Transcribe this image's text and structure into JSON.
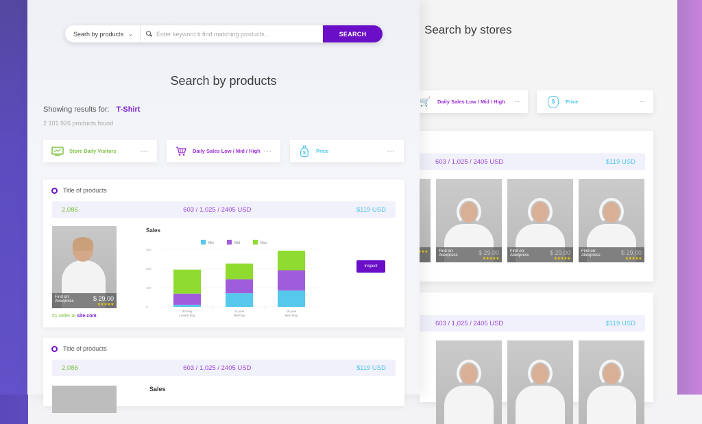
{
  "products_panel": {
    "search": {
      "select_value": "Searh by products",
      "placeholder": "Enter keyword ti find matching products...",
      "button": "SEARCH"
    },
    "title": "Search by products",
    "showing_label": "Showing results for:",
    "search_term": "T-Shirt",
    "found": "2 101 926 products found",
    "filters": [
      {
        "icon": "monitor-chart-icon",
        "label": "Store Daily Visitors",
        "color": "#7cc240"
      },
      {
        "icon": "shopping-cart-icon",
        "label": "Daily Sales Low / Mid / High",
        "color": "#9b2fd6"
      },
      {
        "icon": "money-bag-icon",
        "label": "Price",
        "color": "#4cc4e8"
      }
    ],
    "more": "···",
    "cards": [
      {
        "title": "Title of products",
        "visitors": "2,086",
        "sales": "603 / 1,025 / 2405 USD",
        "price": "$119 USD",
        "product": {
          "find_on": "Find on:",
          "store": "Aliexpress",
          "price": "$ 29.00",
          "stars": "★★★★★",
          "seller_prefix": "#1 seller at",
          "seller_site": "site.com"
        },
        "inspect": "Inspect"
      },
      {
        "title": "Title of products",
        "visitors": "2,086",
        "sales": "603 / 1,025 / 2405 USD",
        "price": "$119 USD",
        "chart_title": "Sales"
      }
    ]
  },
  "chart_data": {
    "type": "bar",
    "stacked": true,
    "title": "Sales",
    "categories": [
      "30 may|Lowest Day",
      "14 june|Mid Day",
      "15 june|Best Day"
    ],
    "series": [
      {
        "name": "Min",
        "color": "#55c8ec",
        "values": [
          11,
          71,
          85
        ]
      },
      {
        "name": "Mid",
        "color": "#a05ddb",
        "values": [
          58,
          73,
          106
        ]
      },
      {
        "name": "Max",
        "color": "#8fdb2f",
        "values": [
          125,
          82,
          102
        ]
      }
    ],
    "yticks": [
      0,
      100,
      200,
      300
    ],
    "ylim": [
      0,
      300
    ],
    "legend": "top-center",
    "grid": true
  },
  "stores_panel": {
    "title": "Search by stores",
    "filters": [
      {
        "icon": "shopping-cart-icon",
        "label": "Daily Sales Low / Mid / High",
        "color": "#9b2fd6"
      },
      {
        "icon": "money-bag-icon",
        "label": "Price",
        "color": "#4cc4e8"
      }
    ],
    "more": "···",
    "cards": [
      {
        "sales": "603 / 1,025 / 2405 USD",
        "price": "$119 USD"
      },
      {
        "sales": "603 / 1,025 / 2405 USD",
        "price": "$119 USD"
      }
    ],
    "tile": {
      "find_on": "Find on:",
      "store": "Aliexpress",
      "price": "$ 29.00",
      "stars": "★★★★★"
    }
  }
}
